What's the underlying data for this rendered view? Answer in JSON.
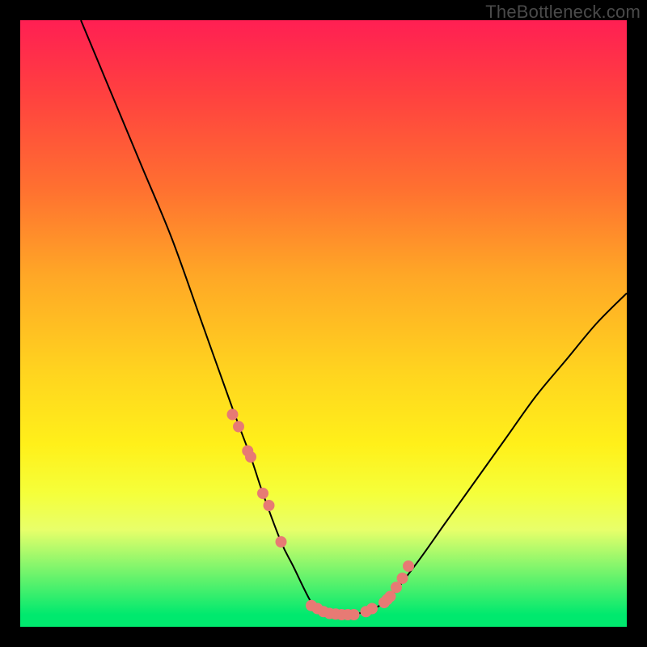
{
  "watermark": "TheBottleneck.com",
  "chart_data": {
    "type": "line",
    "title": "",
    "xlabel": "",
    "ylabel": "",
    "xlim": [
      0,
      100
    ],
    "ylim": [
      0,
      100
    ],
    "series": [
      {
        "name": "curve",
        "x": [
          10,
          15,
          20,
          25,
          30,
          35,
          38,
          40,
          43,
          45,
          48,
          50,
          53,
          55,
          60,
          65,
          70,
          75,
          80,
          85,
          90,
          95,
          100
        ],
        "y": [
          100,
          88,
          76,
          64,
          50,
          36,
          28,
          22,
          14,
          10,
          4,
          2,
          2,
          2,
          4,
          10,
          17,
          24,
          31,
          38,
          44,
          50,
          55
        ]
      }
    ],
    "highlight_points": {
      "name": "markers",
      "x": [
        35,
        36,
        37.5,
        38,
        40,
        41,
        43,
        48,
        49,
        50,
        51,
        52,
        53,
        54,
        55,
        57,
        58,
        60,
        60.5,
        61,
        62,
        63,
        64
      ],
      "y": [
        35,
        33,
        29,
        28,
        22,
        20,
        14,
        3.5,
        3,
        2.5,
        2.2,
        2.1,
        2,
        2,
        2,
        2.5,
        3,
        4,
        4.5,
        5,
        6.5,
        8,
        10
      ]
    },
    "gradient_stops": [
      {
        "pos": 0,
        "color": "#ff1f53"
      },
      {
        "pos": 12,
        "color": "#ff4040"
      },
      {
        "pos": 28,
        "color": "#ff7130"
      },
      {
        "pos": 42,
        "color": "#ffa726"
      },
      {
        "pos": 58,
        "color": "#ffd41f"
      },
      {
        "pos": 70,
        "color": "#fff01a"
      },
      {
        "pos": 78,
        "color": "#f5ff3a"
      },
      {
        "pos": 84,
        "color": "#e8ff6a"
      },
      {
        "pos": 98,
        "color": "#00e96e"
      },
      {
        "pos": 100,
        "color": "#00e96e"
      }
    ]
  }
}
